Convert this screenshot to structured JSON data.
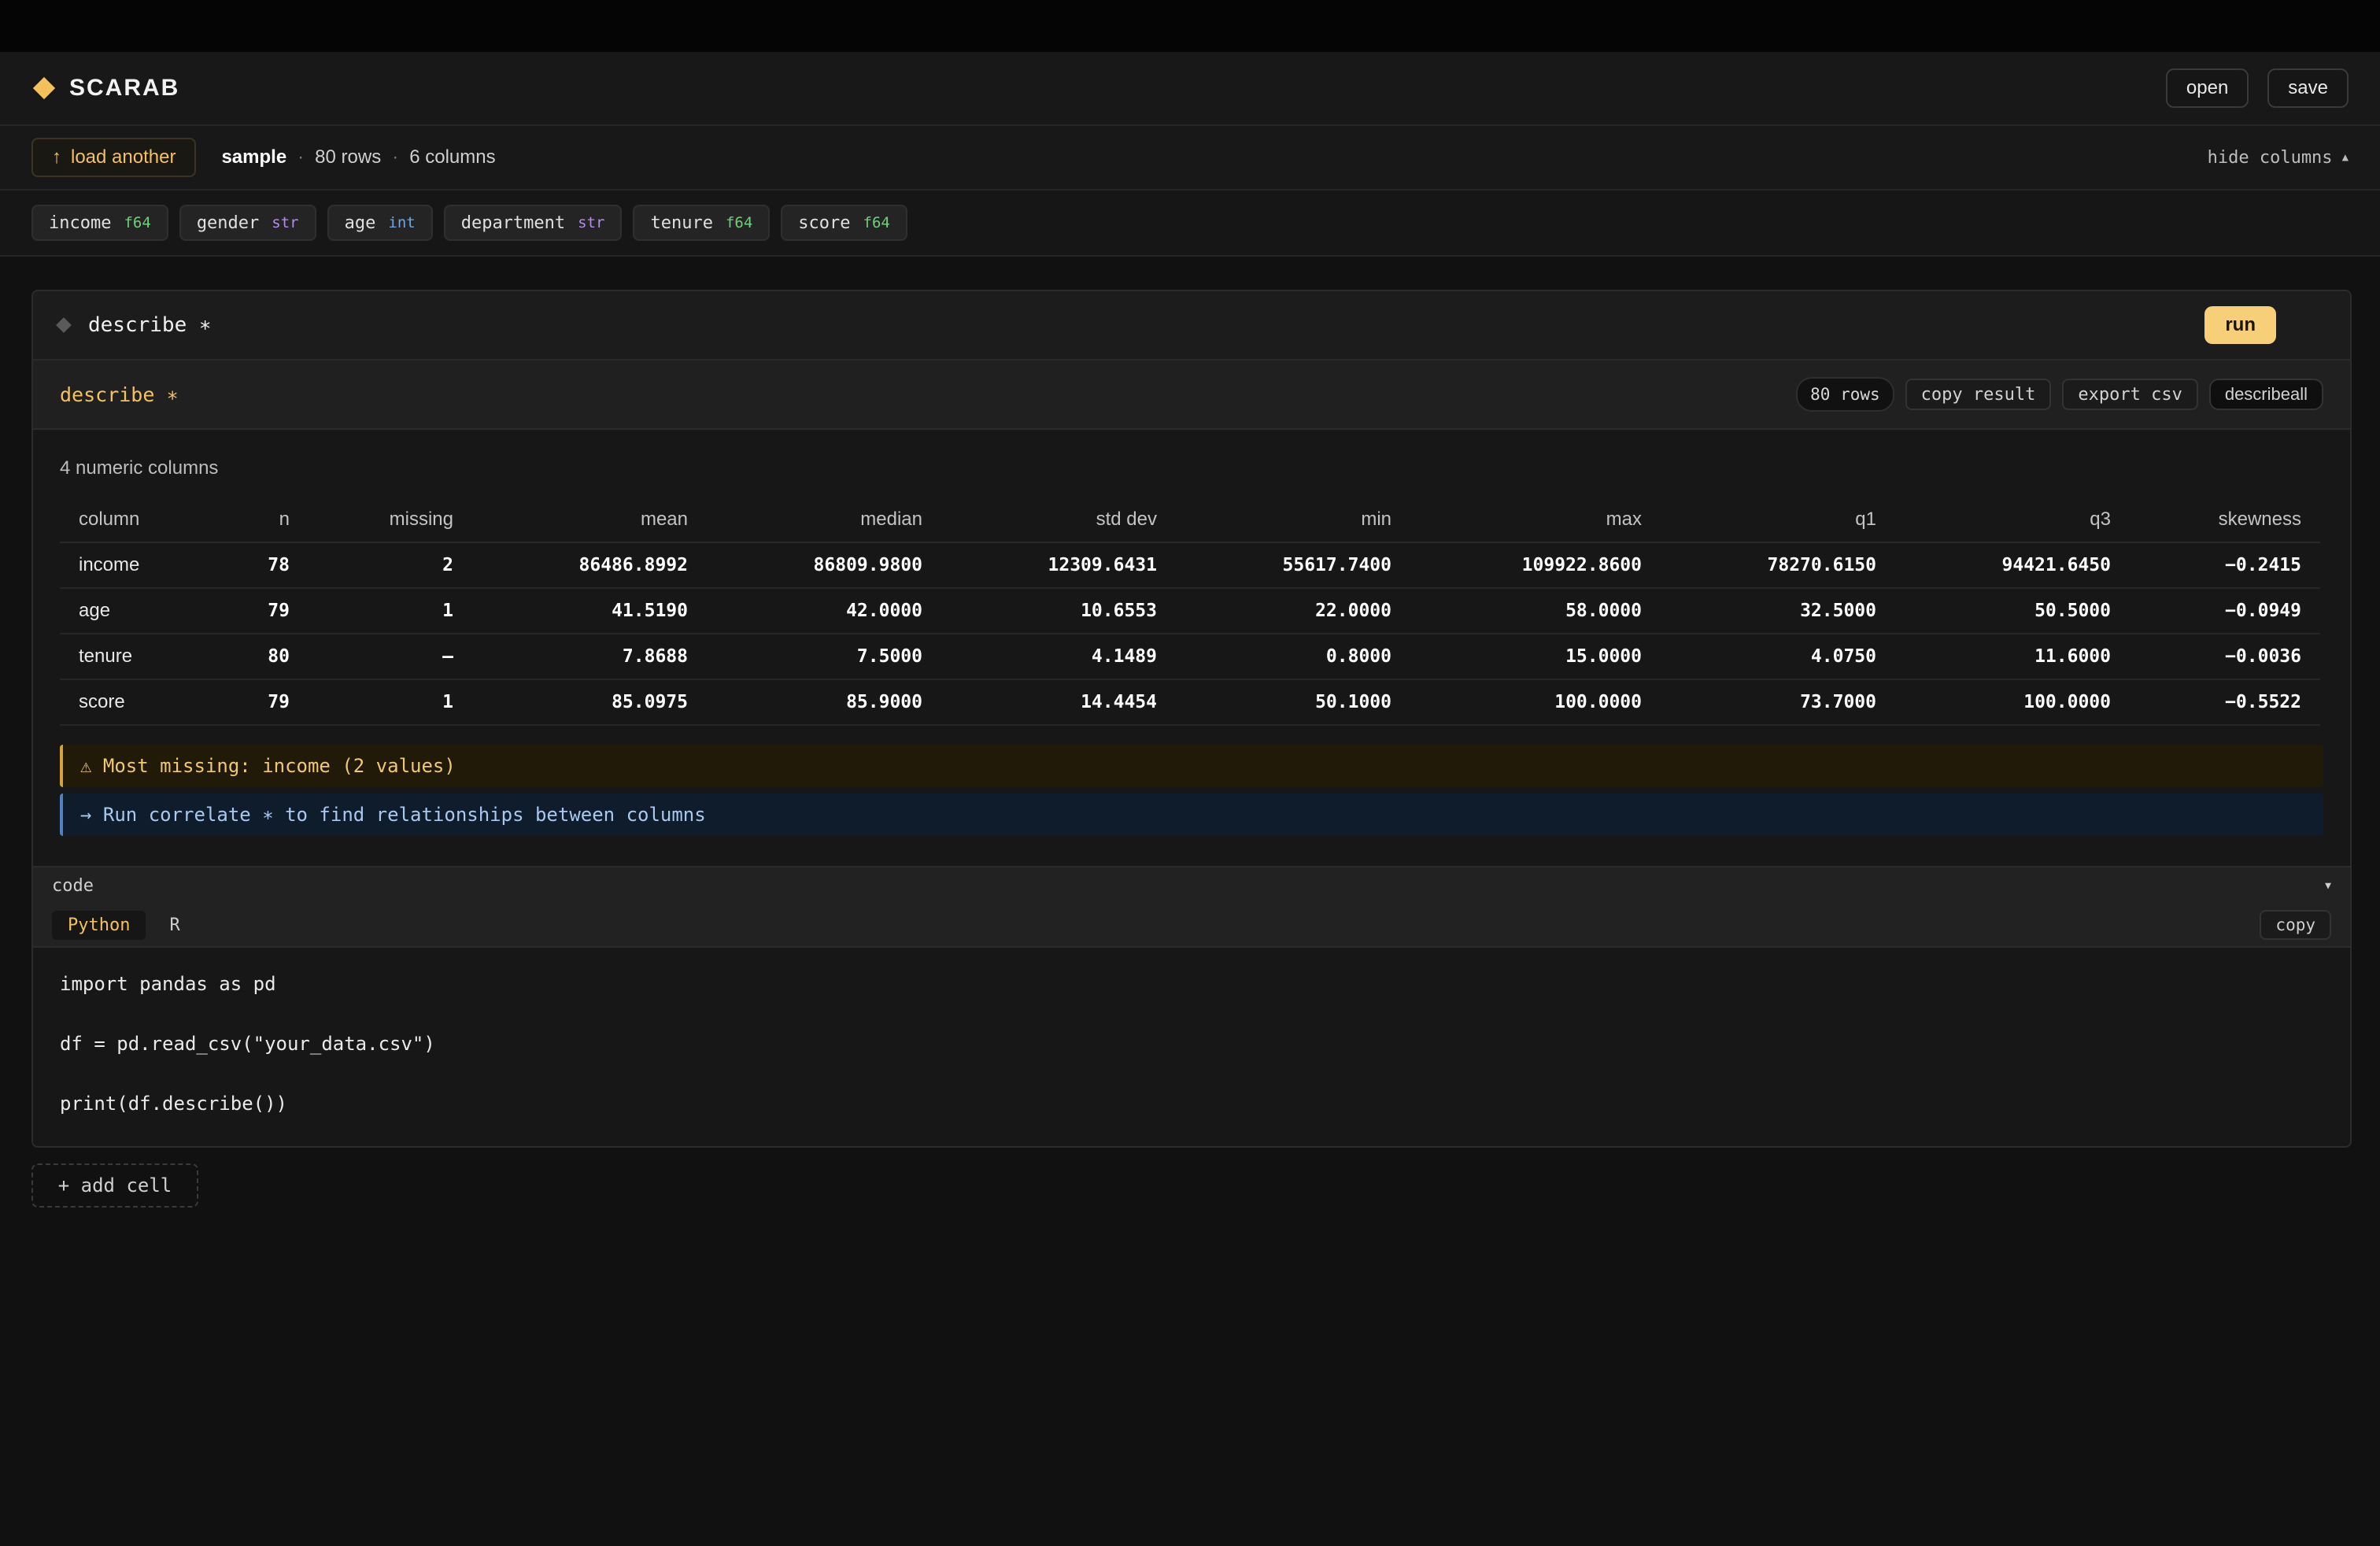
{
  "app": {
    "name": "SCARAB"
  },
  "header": {
    "open_label": "open",
    "save_label": "save"
  },
  "dataset": {
    "load_label": "load another",
    "name": "sample",
    "rows": "80 rows",
    "columns": "6 columns",
    "hide_columns_label": "hide columns"
  },
  "columns": [
    {
      "name": "income",
      "type": "f64"
    },
    {
      "name": "gender",
      "type": "str"
    },
    {
      "name": "age",
      "type": "int"
    },
    {
      "name": "department",
      "type": "str"
    },
    {
      "name": "tenure",
      "type": "f64"
    },
    {
      "name": "score",
      "type": "f64"
    }
  ],
  "cell": {
    "title": "describe ∗",
    "run_label": "run",
    "result": {
      "title": "describe ∗",
      "rows_pill": "80 rows",
      "copy_result_label": "copy result",
      "export_csv_label": "export csv",
      "describeall_label": "describeall",
      "note": "4 numeric columns",
      "headers": [
        "column",
        "n",
        "missing",
        "mean",
        "median",
        "std dev",
        "min",
        "max",
        "q1",
        "q3",
        "skewness"
      ],
      "rows": [
        [
          "income",
          "78",
          "2",
          "86486.8992",
          "86809.9800",
          "12309.6431",
          "55617.7400",
          "109922.8600",
          "78270.6150",
          "94421.6450",
          "−0.2415"
        ],
        [
          "age",
          "79",
          "1",
          "41.5190",
          "42.0000",
          "10.6553",
          "22.0000",
          "58.0000",
          "32.5000",
          "50.5000",
          "−0.0949"
        ],
        [
          "tenure",
          "80",
          "—",
          "7.8688",
          "7.5000",
          "4.1489",
          "0.8000",
          "15.0000",
          "4.0750",
          "11.6000",
          "−0.0036"
        ],
        [
          "score",
          "79",
          "1",
          "85.0975",
          "85.9000",
          "14.4454",
          "50.1000",
          "100.0000",
          "73.7000",
          "100.0000",
          "−0.5522"
        ]
      ],
      "warning": "⚠ Most missing: income (2 values)",
      "hint": "→ Run correlate ∗ to find relationships between columns"
    },
    "code": {
      "section_label": "code",
      "tabs": [
        "Python",
        "R"
      ],
      "copy_label": "copy",
      "lines": [
        "import pandas as pd",
        "df = pd.read_csv(\"your_data.csv\")",
        "print(df.describe())"
      ]
    }
  },
  "add_cell_label": "+ add cell",
  "colors": {
    "accent": "#f4c15d",
    "f64": "#6fcf7a",
    "str": "#b48cf0",
    "int": "#6ba8f0"
  },
  "icons": {
    "brand": "diamond-icon",
    "load": "arrow-up-icon",
    "hide": "caret-up-icon",
    "code_toggle": "caret-down-icon"
  }
}
